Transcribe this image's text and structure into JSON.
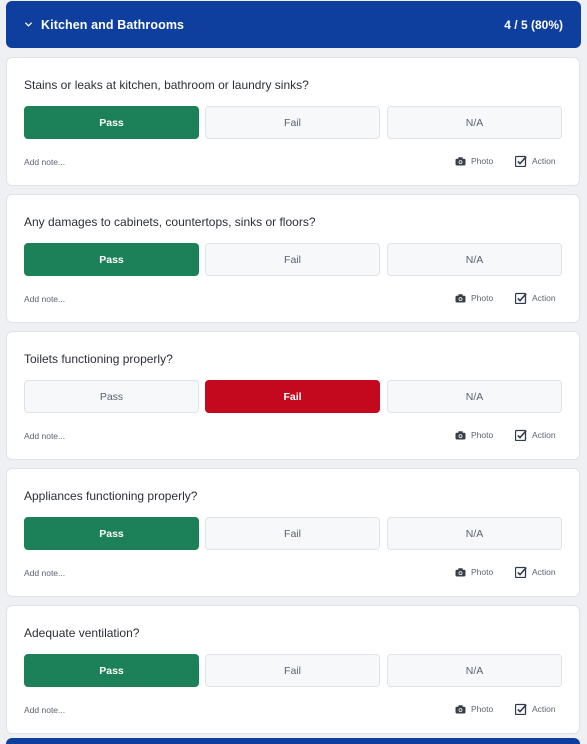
{
  "section": {
    "title": "Kitchen and Bathrooms",
    "score": "4 / 5 (80%)"
  },
  "common": {
    "pass_label": "Pass",
    "fail_label": "Fail",
    "na_label": "N/A",
    "add_note_label": "Add note...",
    "photo_label": "Photo",
    "action_label": "Action"
  },
  "items": [
    {
      "question": "Stains or leaks at kitchen, bathroom or laundry sinks?",
      "selected": "Pass"
    },
    {
      "question": "Any damages to cabinets, countertops, sinks or floors?",
      "selected": "Pass"
    },
    {
      "question": "Toilets functioning properly?",
      "selected": "Fail"
    },
    {
      "question": "Appliances functioning properly?",
      "selected": "Pass"
    },
    {
      "question": "Adequate ventilation?",
      "selected": "Pass"
    }
  ],
  "colors": {
    "header_bg": "#0f3f9e",
    "pass_selected": "#1c8159",
    "fail_selected": "#c4081d"
  },
  "icons": {
    "header": "chevron-down-icon",
    "photo": "camera-icon",
    "action": "checkbox-icon"
  }
}
